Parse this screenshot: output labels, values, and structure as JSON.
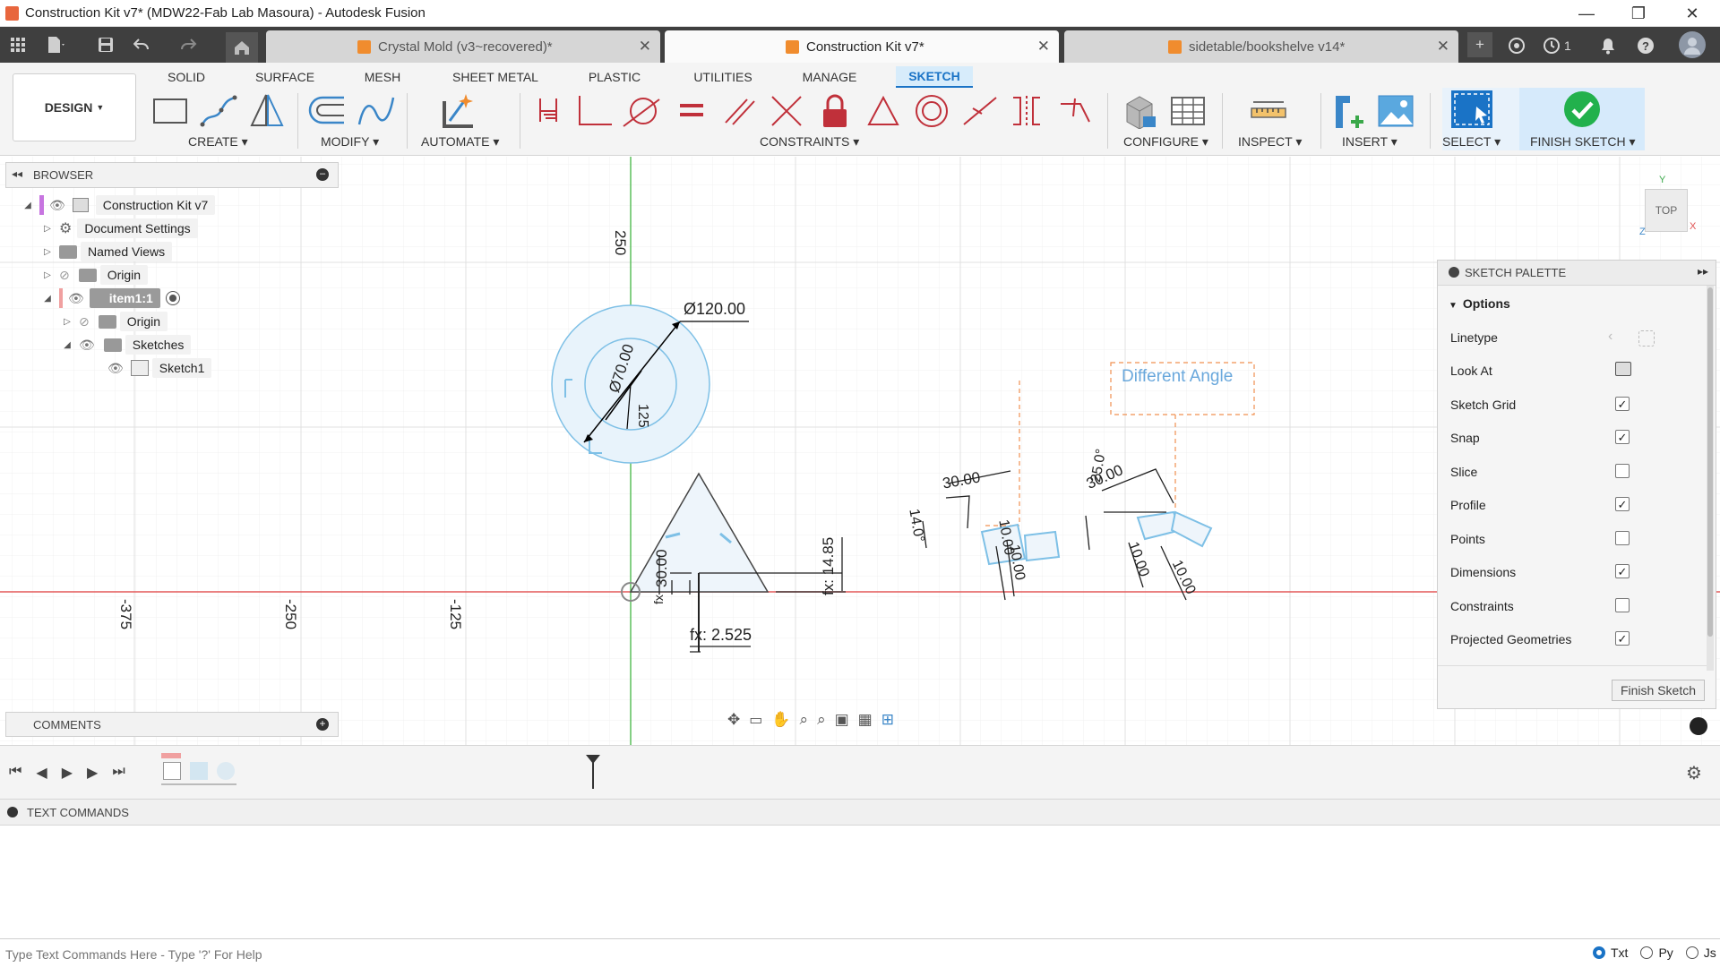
{
  "window": {
    "title": "Construction Kit v7* (MDW22-Fab Lab Masoura) - Autodesk Fusion",
    "minimize": "—",
    "maximize": "❐",
    "close": "✕"
  },
  "tabs": [
    {
      "label": "Crystal Mold (v3~recovered)*",
      "active": false
    },
    {
      "label": "Construction Kit v7*",
      "active": true
    },
    {
      "label": "sidetable/bookshelve v14*",
      "active": false
    }
  ],
  "tabbar_right": {
    "jobs_count": "1"
  },
  "ribbon": {
    "workspace": "DESIGN",
    "tabs": [
      "SOLID",
      "SURFACE",
      "MESH",
      "SHEET METAL",
      "PLASTIC",
      "UTILITIES",
      "MANAGE",
      "SKETCH"
    ],
    "active_tab": "SKETCH",
    "groups": {
      "create": "CREATE",
      "modify": "MODIFY",
      "automate": "AUTOMATE",
      "constraints": "CONSTRAINTS",
      "configure": "CONFIGURE",
      "inspect": "INSPECT",
      "insert": "INSERT",
      "select": "SELECT",
      "finish": "FINISH SKETCH"
    }
  },
  "browser": {
    "title": "BROWSER",
    "items": [
      {
        "label": "Construction Kit v7"
      },
      {
        "label": "Document Settings"
      },
      {
        "label": "Named Views"
      },
      {
        "label": "Origin"
      },
      {
        "label": "item1:1"
      },
      {
        "label": "Origin"
      },
      {
        "label": "Sketches"
      },
      {
        "label": "Sketch1"
      }
    ]
  },
  "comments": {
    "title": "COMMENTS"
  },
  "viewcube": {
    "face": "TOP",
    "x": "X",
    "y": "Y",
    "z": "Z"
  },
  "sketch": {
    "axis_labels": {
      "v250": "250",
      "h375": "-375",
      "h250": "-250",
      "h125": "-125"
    },
    "dims": {
      "d120": "Ø120.00",
      "d70": "Ø70.00",
      "r125": "125",
      "t30": "30.00",
      "fx1485": "fx: 14.85",
      "fx2525": "fx: 2.525",
      "fx_small": "fx",
      "a30": "30.00",
      "a14": "14.0°",
      "a10a": "10.00",
      "a10b": "10.00",
      "b30": "30.00",
      "b25": "25.0°",
      "b10a": "10.00",
      "b10b": "10.00"
    },
    "annotation": "Different Angle"
  },
  "palette": {
    "title": "SKETCH PALETTE",
    "section": "Options",
    "rows": [
      {
        "label": "Linetype",
        "type": "icons"
      },
      {
        "label": "Look At",
        "type": "icon"
      },
      {
        "label": "Sketch Grid",
        "checked": true
      },
      {
        "label": "Snap",
        "checked": true
      },
      {
        "label": "Slice",
        "checked": false
      },
      {
        "label": "Profile",
        "checked": true
      },
      {
        "label": "Points",
        "checked": false
      },
      {
        "label": "Dimensions",
        "checked": true
      },
      {
        "label": "Constraints",
        "checked": false
      },
      {
        "label": "Projected Geometries",
        "checked": true
      }
    ],
    "finish_button": "Finish Sketch"
  },
  "text_commands": {
    "title": "TEXT COMMANDS",
    "placeholder": "Type Text Commands Here - Type '?' For Help",
    "modes": [
      "Txt",
      "Py",
      "Js"
    ],
    "selected_mode": "Txt"
  },
  "colors": {
    "accent": "#1a73c6",
    "sketch_fill": "#e8f3fb",
    "sketch_stroke": "#7ec0e6",
    "x_axis": "#e05050",
    "y_axis": "#4cb04c",
    "construction": "#f09050"
  }
}
